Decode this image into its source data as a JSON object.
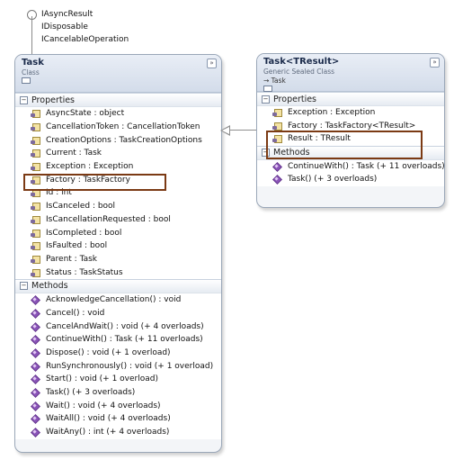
{
  "interfaces": [
    "IAsyncResult",
    "IDisposable",
    "ICancelableOperation"
  ],
  "task_class": {
    "name": "Task",
    "kind": "Class",
    "properties_label": "Properties",
    "properties": [
      "AsyncState : object",
      "CancellationToken : CancellationToken",
      "CreationOptions : TaskCreationOptions",
      "Current : Task",
      "Exception : Exception",
      "Factory : TaskFactory",
      "Id : int",
      "IsCanceled : bool",
      "IsCancellationRequested : bool",
      "IsCompleted : bool",
      "IsFaulted : bool",
      "Parent : Task",
      "Status : TaskStatus"
    ],
    "methods_label": "Methods",
    "methods": [
      "AcknowledgeCancellation() : void",
      "Cancel() : void",
      "CancelAndWait() : void (+ 4 overloads)",
      "ContinueWith() : Task (+ 11 overloads)",
      "Dispose() : void (+ 1 overload)",
      "RunSynchronously() : void (+ 1 overload)",
      "Start() : void (+ 1 overload)",
      "Task() (+ 3 overloads)",
      "Wait() : void (+ 4 overloads)",
      "WaitAll() : void (+ 4 overloads)",
      "WaitAny() : int (+ 4 overloads)"
    ]
  },
  "task_tresult_class": {
    "name": "Task<TResult>",
    "kind": "Generic Sealed Class",
    "base": "→ Task",
    "properties_label": "Properties",
    "properties": [
      "Exception : Exception",
      "Factory : TaskFactory<TResult>",
      "Result : TResult"
    ],
    "methods_label": "Methods",
    "methods": [
      "ContinueWith() : Task (+ 11 overloads)",
      "Task() (+ 3 overloads)"
    ]
  },
  "collapse_glyph": "»",
  "section_toggle_glyph": "−",
  "colors": {
    "highlight": "#7b3a14",
    "header": "#d3dcea",
    "border": "#9aa7b8"
  }
}
